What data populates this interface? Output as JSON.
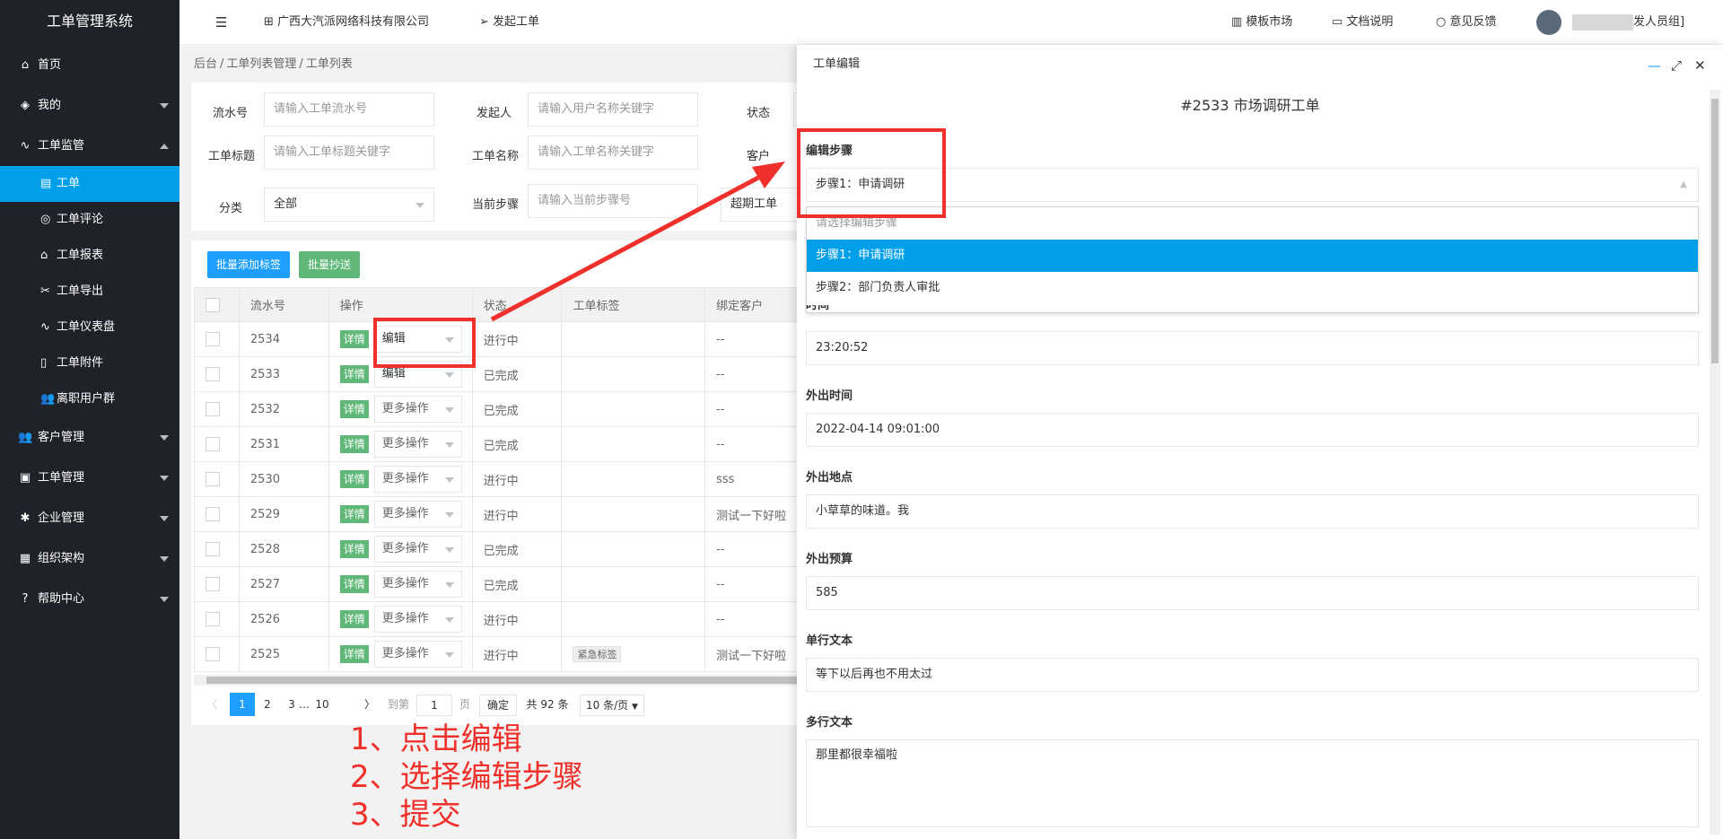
{
  "app": {
    "title": "工单管理系统"
  },
  "sidebar": {
    "home": "首页",
    "mine": "我的",
    "monitor": "工单监管",
    "monitor_items": [
      "工单",
      "工单评论",
      "工单报表",
      "工单导出",
      "工单仪表盘",
      "工单附件",
      "离职用户群"
    ],
    "customer": "客户管理",
    "ticket_manage": "工单管理",
    "enterprise": "企业管理",
    "org": "组织架构",
    "help": "帮助中心"
  },
  "header": {
    "menu_icon": "☰",
    "company": "广西大汽派网络科技有限公司",
    "create": "发起工单",
    "template_market": "模板市场",
    "docs": "文档说明",
    "feedback": "意见反馈",
    "user_suffix": "发人员组]"
  },
  "breadcrumb": [
    "后台",
    "工单列表管理",
    "工单列表"
  ],
  "filters": {
    "serial_label": "流水号",
    "serial_placeholder": "请输入工单流水号",
    "initiator_label": "发起人",
    "initiator_placeholder": "请输入用户名称关键字",
    "status_label": "状态",
    "title_label": "工单标题",
    "title_placeholder": "请输入工单标题关键字",
    "name_label": "工单名称",
    "name_placeholder": "请输入工单名称关键字",
    "customer_label": "客户",
    "category_label": "分类",
    "category_value": "全部",
    "step_label": "当前步骤",
    "step_placeholder": "请输入当前步骤号",
    "overdue_label": "超期工单"
  },
  "toolbar": {
    "batch_tag": "批量添加标签",
    "batch_cc": "批量抄送"
  },
  "table": {
    "columns": [
      "流水号",
      "操作",
      "状态",
      "工单标签",
      "绑定客户"
    ],
    "detail_label": "详情",
    "rows": [
      {
        "id": "2534",
        "op": "编辑",
        "status": "进行中",
        "tag": "",
        "customer": "--"
      },
      {
        "id": "2533",
        "op": "编辑",
        "status": "已完成",
        "tag": "",
        "customer": "--"
      },
      {
        "id": "2532",
        "op": "更多操作",
        "status": "已完成",
        "tag": "",
        "customer": "--"
      },
      {
        "id": "2531",
        "op": "更多操作",
        "status": "已完成",
        "tag": "",
        "customer": "--"
      },
      {
        "id": "2530",
        "op": "更多操作",
        "status": "进行中",
        "tag": "",
        "customer": "sss"
      },
      {
        "id": "2529",
        "op": "更多操作",
        "status": "进行中",
        "tag": "",
        "customer": "测试一下好啦"
      },
      {
        "id": "2528",
        "op": "更多操作",
        "status": "已完成",
        "tag": "",
        "customer": "--"
      },
      {
        "id": "2527",
        "op": "更多操作",
        "status": "已完成",
        "tag": "",
        "customer": "--"
      },
      {
        "id": "2526",
        "op": "更多操作",
        "status": "进行中",
        "tag": "",
        "customer": "--"
      },
      {
        "id": "2525",
        "op": "更多操作",
        "status": "进行中",
        "tag": "紧急标签",
        "customer": "测试一下好啦"
      }
    ]
  },
  "pager": {
    "prev": "〈",
    "p1": "1",
    "p2": "2",
    "p3": "3",
    "ellipsis": "…",
    "p10": "10",
    "next": "〉",
    "goto_label": "到第",
    "goto_value": "1",
    "page_unit": "页",
    "confirm": "确定",
    "total": "共 92 条",
    "page_size": "10 条/页"
  },
  "annotations": [
    "1、点击编辑",
    "2、选择编辑步骤",
    "3、提交"
  ],
  "panel": {
    "title": "工单编辑",
    "heading": "#2533 市场调研工单",
    "step_label": "编辑步骤",
    "step_value": "步骤1：申请调研",
    "dropdown_options": [
      "请选择编辑步骤",
      "步骤1：申请调研",
      "步骤2：部门负责人审批"
    ],
    "time_label": "时间",
    "time_value": "23:20:52",
    "out_time_label": "外出时间",
    "out_time_value": "2022-04-14 09:01:00",
    "place_label": "外出地点",
    "place_value": "小草草的味道。我",
    "budget_label": "外出预算",
    "budget_value": "585",
    "single_label": "单行文本",
    "single_value": "等下以后再也不用太过",
    "multi_label": "多行文本",
    "multi_value": "那里都很幸福啦"
  },
  "colors": {
    "sidebar_bg": "#20222a",
    "active_blue": "#009fe9",
    "done_green": "#5fb878",
    "run_blue": "#1e9fff",
    "annotation_red": "#f0302a"
  }
}
